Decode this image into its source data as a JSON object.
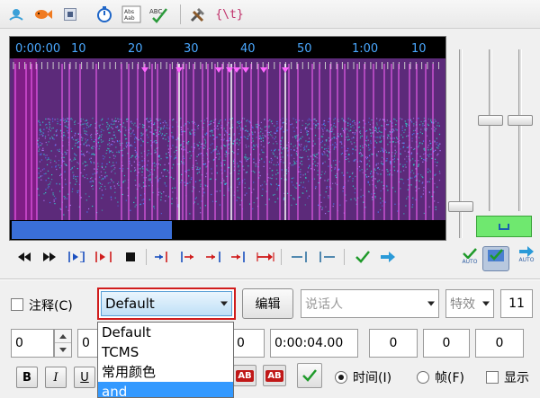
{
  "toolbar": {
    "items": [
      {
        "name": "open-icon"
      },
      {
        "name": "fish-icon"
      },
      {
        "name": "stop-square-icon"
      },
      {
        "name": "timer-icon"
      },
      {
        "name": "font-info-icon"
      },
      {
        "name": "spellcheck-icon"
      },
      {
        "name": "tools-icon"
      },
      {
        "name": "tag-icon",
        "label": "{\\t}"
      }
    ]
  },
  "timeline": {
    "ticks": [
      "0:00:00",
      "10",
      "20",
      "30",
      "40",
      "50",
      "1:00",
      "10"
    ]
  },
  "transport": {
    "auto_label": "AUTO"
  },
  "form": {
    "comment_label": "注释(C)",
    "style_value": "Default",
    "edit_button": "编辑",
    "actor_placeholder": "说话人",
    "effect_value": "特效",
    "layer_value": "11",
    "start_field": "0",
    "second_field": "0",
    "duration_field": "0:00:04.00",
    "margin_left": "0",
    "margin_right": "0",
    "margin_vertical": "0",
    "bold_label": "B",
    "italic_label": "I",
    "underline_label": "U",
    "ab_label": "AB",
    "time_radio_label": "时间(I)",
    "frame_radio_label": "帧(F)",
    "show_label": "显示"
  },
  "style_dropdown": {
    "options": [
      "Default",
      "TCMS",
      "常用颜色",
      "and"
    ],
    "selected_index": 3
  },
  "colors": {
    "spectrogram_bg": "#5c2a7a",
    "marker": "#ff66ff",
    "progress": "#3a6fd8",
    "highlight_green": "#6fe86f",
    "dropdown_focus": "#d01c1c"
  }
}
